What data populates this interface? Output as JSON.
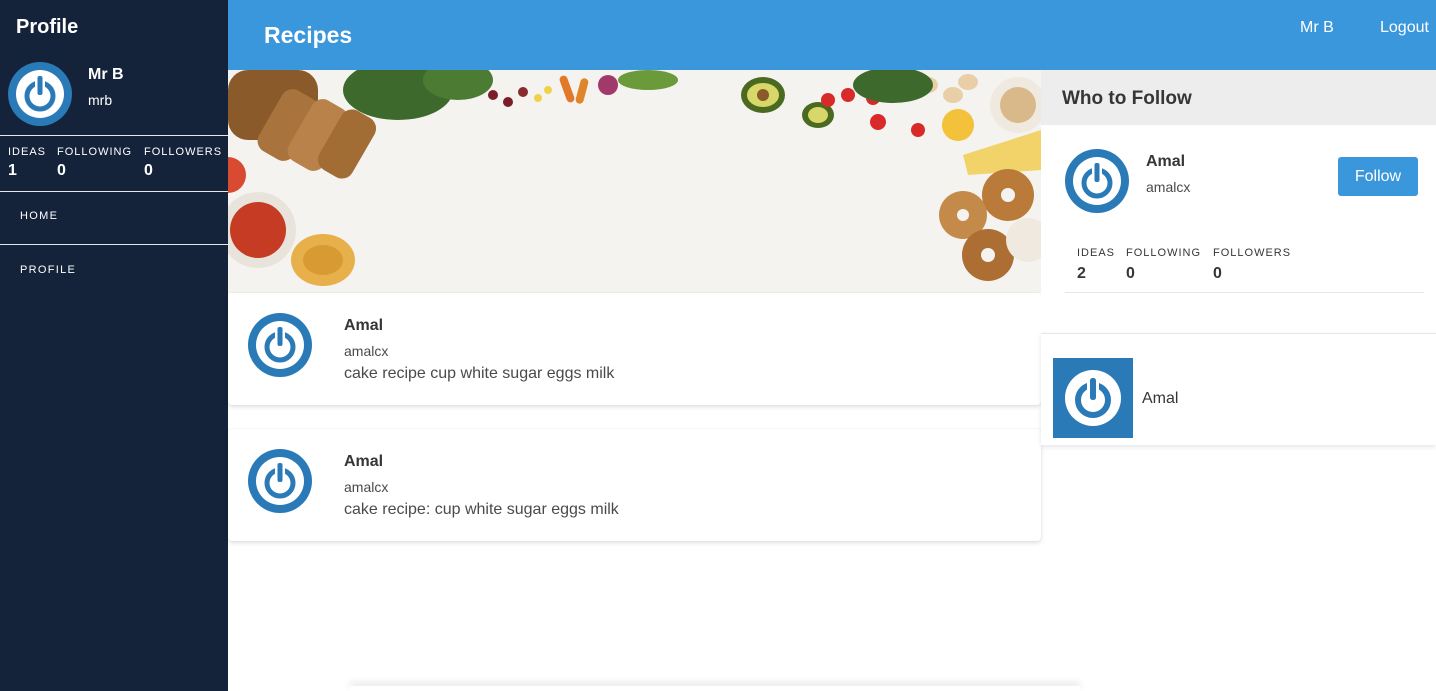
{
  "sidebar": {
    "title": "Profile",
    "user": {
      "name": "Mr B",
      "handle": "mrb"
    },
    "stats": [
      {
        "label": "IDEAS",
        "value": "1"
      },
      {
        "label": "FOLLOWING",
        "value": "0"
      },
      {
        "label": "FOLLOWERS",
        "value": "0"
      }
    ],
    "nav": [
      {
        "label": "HOME"
      },
      {
        "label": "PROFILE"
      }
    ]
  },
  "header": {
    "title": "Recipes",
    "user_link": "Mr B",
    "logout_label": "Logout"
  },
  "feed": [
    {
      "name": "Amal",
      "handle": "amalcx",
      "text": "cake recipe cup white sugar eggs milk"
    },
    {
      "name": "Amal",
      "handle": "amalcx",
      "text": "cake recipe: cup white sugar eggs milk"
    }
  ],
  "who_to_follow": {
    "title": "Who to Follow",
    "user": {
      "name": "Amal",
      "handle": "amalcx"
    },
    "follow_label": "Follow",
    "stats": [
      {
        "label": "IDEAS",
        "value": "2"
      },
      {
        "label": "FOLLOWING",
        "value": "0"
      },
      {
        "label": "FOLLOWERS",
        "value": "0"
      }
    ],
    "mini": {
      "name": "Amal"
    }
  },
  "colors": {
    "sidebar_bg": "#14233a",
    "header_bg": "#3b97dc",
    "avatar_blue": "#2a7ab8"
  },
  "icons": {
    "avatar": "power-icon",
    "hero": "food-banner-image"
  }
}
